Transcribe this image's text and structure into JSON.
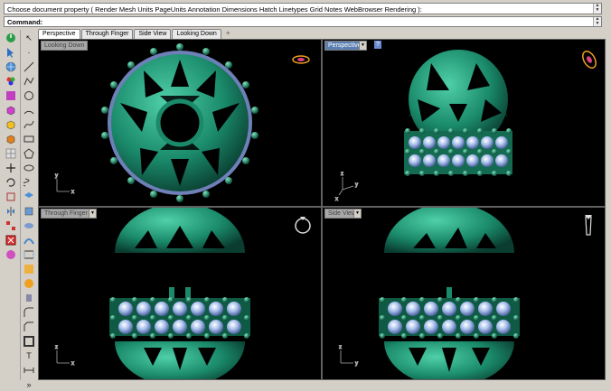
{
  "command_history": "Choose document property ( Render Mesh Units PageUnits Annotation Dimensions Hatch Linetypes Grid Notes WebBrowser Rendering ):",
  "command_label": "Command:",
  "tabs": [
    {
      "label": "Perspective",
      "active": true
    },
    {
      "label": "Through Finger",
      "active": false
    },
    {
      "label": "Side View",
      "active": false
    },
    {
      "label": "Looking Down",
      "active": false
    }
  ],
  "tab_add": "+",
  "viewports": {
    "top_left": {
      "title": "Looking Down"
    },
    "top_right": {
      "title": "Perspective",
      "help": "?"
    },
    "bottom_left": {
      "title": "Through Finger"
    },
    "bottom_right": {
      "title": "Side View"
    }
  },
  "axis_labels": {
    "x": "x",
    "y": "y",
    "z": "z"
  },
  "colors": {
    "viewport_bg": "#000000",
    "model": "#1e8a6e",
    "gem": "#9eb8e8",
    "active_title": "#5a7fb0"
  },
  "toolbar_icons": [
    "power-icon",
    "select-icon",
    "globe-icon",
    "colors-icon",
    "box-magenta-icon",
    "cube-icon",
    "cube-yellow-icon",
    "cube-orange-icon",
    "grid-icon",
    "move-icon",
    "rotate-icon",
    "scale-icon",
    "mirror-icon",
    "array-icon",
    "boolean-icon",
    "pink-shape-icon"
  ],
  "toolbar2_icons": [
    "arrow-icon",
    "dot-icon",
    "line-icon",
    "polyline-icon",
    "circle-icon",
    "arc-icon",
    "curve-icon",
    "rectangle-icon",
    "polygon-icon",
    "ellipse-icon",
    "helix-icon",
    "surface-icon",
    "extrude-icon",
    "revolve-icon",
    "sweep-icon",
    "loft-icon",
    "solid-icon",
    "sphere-icon",
    "cylinder-icon",
    "fillet-icon",
    "chamfer-icon",
    "shell-icon",
    "text-icon",
    "dimension-icon",
    "more-icon"
  ]
}
